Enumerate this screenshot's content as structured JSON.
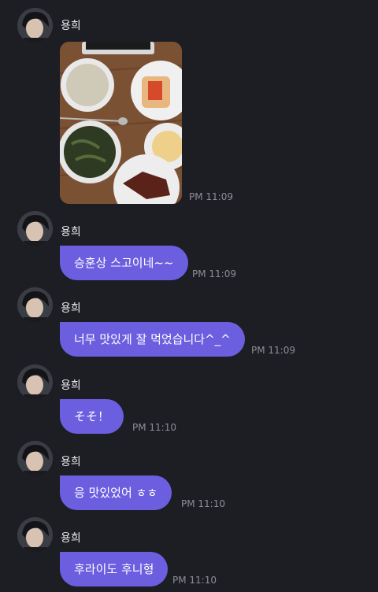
{
  "messages": [
    {
      "sender": "용희",
      "type": "image",
      "time": "PM 11:09",
      "image_alt": "food photo"
    },
    {
      "sender": "용희",
      "type": "text",
      "text": "승훈상 스고이네~~",
      "time": "PM 11:09"
    },
    {
      "sender": "용희",
      "type": "text",
      "text": "너무 맛있게 잘 먹었습니다^_^",
      "time": "PM 11:09"
    },
    {
      "sender": "용희",
      "type": "text",
      "text": "そそ！",
      "time": "PM 11:10"
    },
    {
      "sender": "용희",
      "type": "text",
      "text": "응 맛있었어 ㅎㅎ",
      "time": "PM 11:10"
    },
    {
      "sender": "용희",
      "type": "text",
      "text": "후라이도 후니형",
      "time": "PM 11:10"
    }
  ],
  "colors": {
    "background": "#1d1d24",
    "bubble": "#6b5fe0",
    "timestamp": "#8d8d96"
  }
}
